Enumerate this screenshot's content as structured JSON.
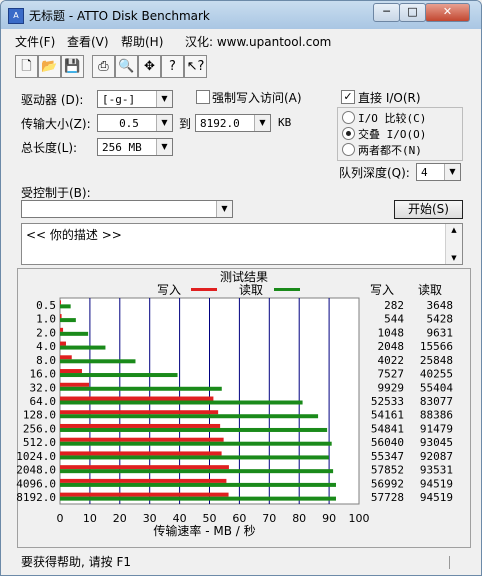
{
  "window": {
    "title": "无标题 - ATTO Disk Benchmark"
  },
  "menu": {
    "file": "文件(F)",
    "view": "查看(V)",
    "help": "帮助(H)",
    "hanhua": "汉化: www.upantool.com"
  },
  "toolbar": {
    "icons": [
      "new-icon",
      "open-icon",
      "save-icon",
      "print-icon",
      "print-preview-icon",
      "move-icon",
      "help-icon",
      "context-help-icon"
    ]
  },
  "form": {
    "drive_label": "驱动器 (D):",
    "drive_value": "[-g-]",
    "direct_write_label": "强制写入访问(A)",
    "transfer_label": "传输大小(Z):",
    "transfer_from": "0.5",
    "to_label": "到",
    "transfer_to": "8192.0",
    "unit": "KB",
    "length_label": "总长度(L):",
    "length_value": "256 MB",
    "direct_io_label": "直接 I/O(R)",
    "io_compare": "I/O 比较(C)",
    "io_overlap": "交叠 I/O(O)",
    "io_neither": "两者都不(N)",
    "queue_label": "队列深度(Q):",
    "queue_value": "4",
    "controlled_by_label": "受控制于(B):",
    "controlled_by_value": "",
    "start_label": "开始(S)",
    "description": "<<  你的描述  >>"
  },
  "results": {
    "title": "测试结果",
    "write_legend": "写入",
    "read_legend": "读取",
    "write_header": "写入",
    "read_header": "读取",
    "xlabel": "传输速率 - MB / 秒",
    "colors": {
      "write": "#e02020",
      "read": "#1a8a1a",
      "grid": "#000080"
    }
  },
  "chart_data": {
    "type": "bar",
    "categories": [
      "0.5",
      "1.0",
      "2.0",
      "4.0",
      "8.0",
      "16.0",
      "32.0",
      "64.0",
      "128.0",
      "256.0",
      "512.0",
      "1024.0",
      "2048.0",
      "4096.0",
      "8192.0"
    ],
    "series": [
      {
        "name": "写入",
        "values": [
          282,
          544,
          1048,
          2048,
          4022,
          7527,
          9929,
          52533,
          54161,
          54841,
          56040,
          55347,
          57852,
          56992,
          57728
        ]
      },
      {
        "name": "读取",
        "values": [
          3648,
          5428,
          9631,
          15566,
          25848,
          40255,
          55404,
          83077,
          88386,
          91479,
          93045,
          92087,
          93531,
          94519,
          94519
        ]
      }
    ],
    "xlim": [
      0,
      100
    ],
    "xticks": [
      "0",
      "10",
      "20",
      "30",
      "40",
      "50",
      "60",
      "70",
      "80",
      "90",
      "100"
    ],
    "unit_note": "values in KB/s; axis MB/s",
    "grid": true
  },
  "status": {
    "text": "要获得帮助, 请按 F1"
  }
}
